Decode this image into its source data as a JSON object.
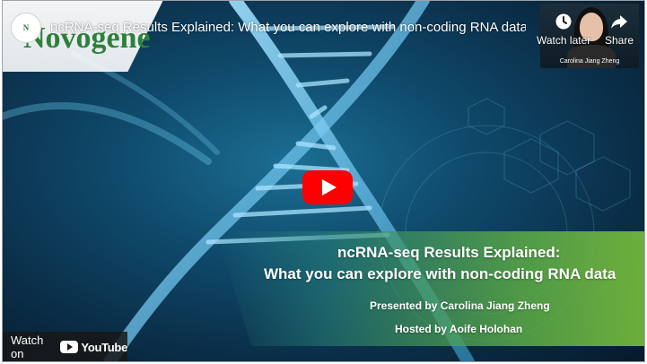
{
  "video": {
    "title": "ncRNA-seq Results Explained: What you can explore with non-coding RNA data",
    "brand": "Novogene"
  },
  "top_controls": {
    "watch_later_label": "Watch later",
    "share_label": "Share"
  },
  "presenter": {
    "name_caption": "Carolina Jiang Zheng"
  },
  "slide": {
    "title_line1": "ncRNA-seq Results Explained:",
    "title_line2": "What you can explore with non-coding RNA data",
    "presented_by": "Presented by Carolina Jiang Zheng",
    "hosted_by": "Hosted by Aoife Holohan"
  },
  "footer": {
    "watch_on_label": "Watch on",
    "youtube_label": "YouTube"
  },
  "colors": {
    "play_red": "#ff0000",
    "brand_green": "#2e7f3b",
    "band_green": "#78be3c"
  },
  "icons": {
    "play": "play-icon",
    "watch_later": "clock-icon",
    "share": "share-arrow-icon",
    "youtube": "youtube-logo-icon"
  }
}
